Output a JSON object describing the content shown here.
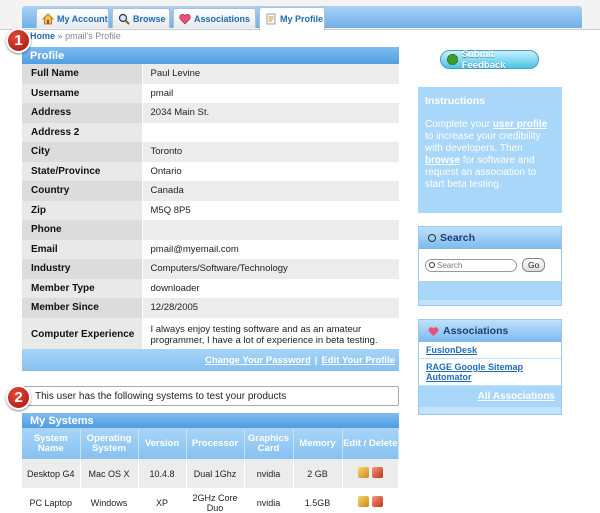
{
  "tabs": [
    {
      "label": "My Account",
      "icon": "house-icon"
    },
    {
      "label": "Browse",
      "icon": "magnifier-icon"
    },
    {
      "label": "Associations",
      "icon": "heart-icon"
    },
    {
      "label": "My Profile",
      "icon": "profile-icon",
      "active": true
    }
  ],
  "breadcrumb": {
    "home": "Home",
    "sep": "»",
    "current": "pmail's Profile"
  },
  "callouts": {
    "one": "1",
    "two": "2"
  },
  "profile": {
    "title": "Profile",
    "rows": [
      {
        "label": "Full Name",
        "value": "Paul Levine"
      },
      {
        "label": "Username",
        "value": "pmail"
      },
      {
        "label": "Address",
        "value": "2034 Main St."
      },
      {
        "label": "Address 2",
        "value": ""
      },
      {
        "label": "City",
        "value": "Toronto"
      },
      {
        "label": "State/Province",
        "value": "Ontario"
      },
      {
        "label": "Country",
        "value": "Canada"
      },
      {
        "label": "Zip",
        "value": "M5Q 8P5"
      },
      {
        "label": "Phone",
        "value": ""
      },
      {
        "label": "Email",
        "value": "pmail@myemail.com"
      },
      {
        "label": "Industry",
        "value": "Computers/Software/Technology"
      },
      {
        "label": "Member Type",
        "value": "downloader"
      },
      {
        "label": "Member Since",
        "value": "12/28/2005"
      },
      {
        "label": "Computer Experience",
        "value": "I always enjoy testing software and as an amateur programmer, I have a lot of experience in beta testing."
      }
    ],
    "change_password": "Change Your Password",
    "separator": "|",
    "edit_profile": "Edit Your Profile"
  },
  "systems": {
    "intro": "This user has the following systems to test your products",
    "title": "My Systems",
    "columns": [
      "System Name",
      "Operating System",
      "Version",
      "Processor",
      "Graphics Card",
      "Memory",
      "Edit / Delete"
    ],
    "rows": [
      [
        "Desktop G4",
        "Mac OS X",
        "10.4.8",
        "Dual 1Ghz",
        "nvidia",
        "2 GB"
      ],
      [
        "PC Laptop",
        "Windows",
        "XP",
        "2GHz Core Duo",
        "nvidia",
        "1.5GB"
      ]
    ]
  },
  "sidebar": {
    "feedback_label": "Submit Feedback",
    "instructions_title": "Instructions",
    "instructions_pre": "Complete your ",
    "instructions_link1": "user profile",
    "instructions_mid": " to increase your credibility with developers. Then ",
    "instructions_link2": "browse",
    "instructions_post": " for software and request an association to start beta testing.",
    "search_title": "Search",
    "search_placeholder": "Search",
    "go_label": "Go",
    "assoc_title": "Associations",
    "assoc_links": [
      "FusionDesk",
      "RAGE Google Sitemap Automator"
    ],
    "all_assoc": "All Associations"
  }
}
